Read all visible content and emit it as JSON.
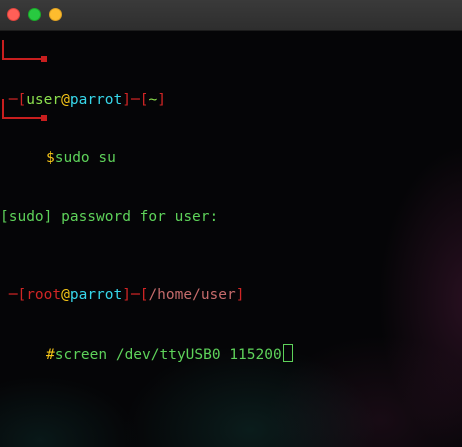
{
  "terminal": {
    "block1": {
      "open_bracket": "┌─[",
      "user": "user",
      "at": "@",
      "host": "parrot",
      "mid": "]─[",
      "dir": "~",
      "close_bracket": "]",
      "prompt_char": "$",
      "command": "sudo su"
    },
    "output": "[sudo] password for user:",
    "block2": {
      "open_bracket": "┌─[",
      "user": "root",
      "at": "@",
      "host": "parrot",
      "mid": "]─[",
      "dir": "/home/user",
      "close_bracket": "]",
      "prompt_char": "#",
      "command": "screen /dev/ttyUSB0 115200"
    }
  },
  "colors": {
    "prompt_red": "#d12525",
    "user_green": "#8ce04e",
    "host_cyan": "#37d7ea",
    "output_green": "#5ed25a",
    "prompt_yellow": "#f5c518"
  }
}
